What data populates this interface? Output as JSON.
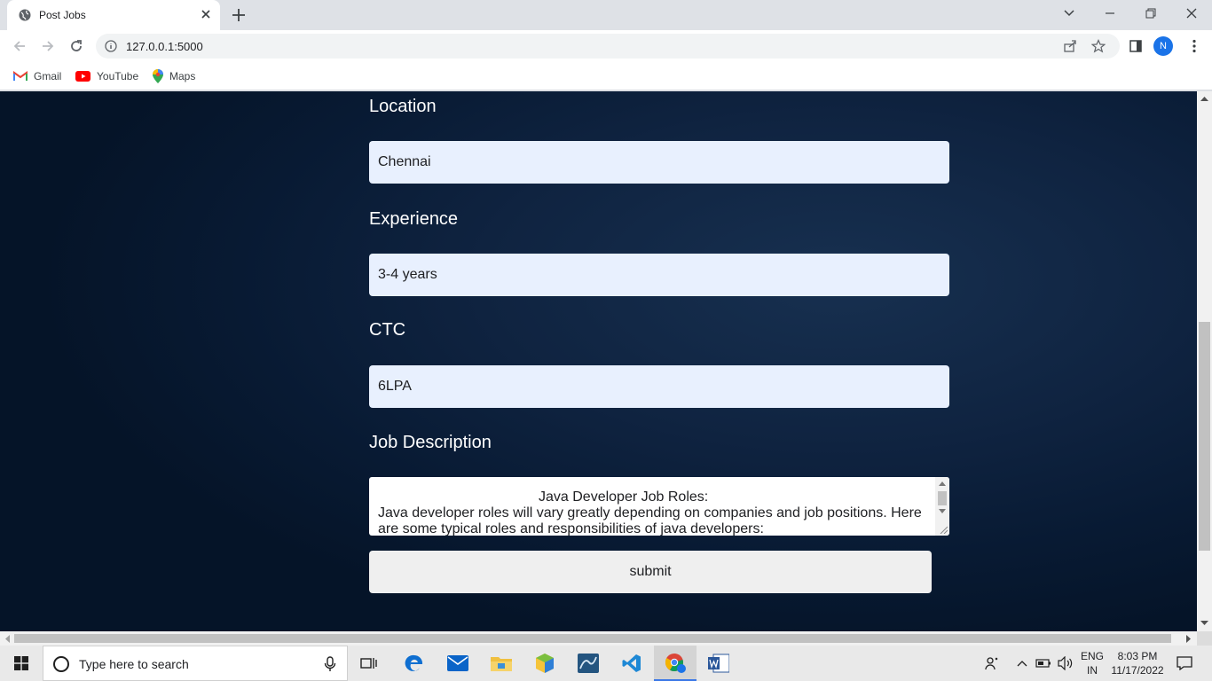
{
  "browser": {
    "tab_title": "Post Jobs",
    "url": "127.0.0.1:5000",
    "profile_initial": "N",
    "bookmarks": [
      "Gmail",
      "YouTube",
      "Maps"
    ]
  },
  "form": {
    "location_label": "Location",
    "location_value": "Chennai",
    "experience_label": "Experience",
    "experience_value": "3-4 years",
    "ctc_label": "CTC",
    "ctc_value": "6LPA",
    "description_label": "Job Description",
    "description_line1": "Java Developer Job Roles:",
    "description_line2": "Java developer roles will vary greatly depending on companies and job positions. Here are some typical roles and responsibilities of java developers:",
    "submit_label": "submit"
  },
  "taskbar": {
    "search_placeholder": "Type here to search",
    "lang_top": "ENG",
    "lang_bottom": "IN",
    "time": "8:03 PM",
    "date": "11/17/2022"
  },
  "colors": {
    "page_background": "#0f2340",
    "input_background": "#e8f0fe",
    "accent": "#1a73e8"
  }
}
